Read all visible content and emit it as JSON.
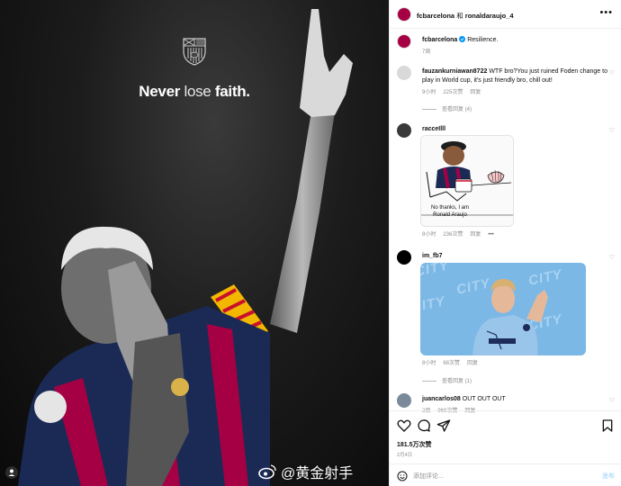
{
  "photo": {
    "tagline_bold_1": "Never",
    "tagline_light": " lose ",
    "tagline_bold_2": "faith."
  },
  "watermark": {
    "text": "@黄金射手"
  },
  "post": {
    "author": "fcbarcelona",
    "joiner": " 和 ",
    "collaborator": "ronaldaraujo_4",
    "more_icon": "more-horizontal-icon",
    "caption_author": "fcbarcelona",
    "caption_text": "Resilience.",
    "caption_time": "7周"
  },
  "comments": [
    {
      "user": "fauzankurniawan8722",
      "text": "WTF bro?You just ruined Foden change to play in World cup, it's just friendly bro, chill out!",
      "time": "9小时",
      "likes": "225次赞",
      "reply": "回复",
      "view_replies": "查看回复 (4)"
    },
    {
      "user": "racceIlll",
      "text": "",
      "time": "8小时",
      "likes": "236次赞",
      "reply": "回复",
      "gif_caption": "No thanks, I am Ronald Araujo"
    },
    {
      "user": "im_fb7",
      "text": "",
      "time": "8小时",
      "likes": "68次赞",
      "reply": "回复",
      "view_replies": "查看回复 (1)",
      "gif_words": [
        "CITY",
        "CITY",
        "CITY",
        "CITY",
        "CITY"
      ]
    },
    {
      "user": "juancarlos08",
      "text": "OUT OUT OUT",
      "time": "2周",
      "likes": "969次赞",
      "reply": "回复"
    }
  ],
  "actions": {
    "likes": "181.5万次赞",
    "date": "2月4日",
    "comment_placeholder": "添加评论...",
    "post_label": "发布"
  },
  "colors": {
    "barca": "#a50044",
    "link_blue_disabled": "#b2dffc",
    "muted": "#8e8e8e"
  }
}
